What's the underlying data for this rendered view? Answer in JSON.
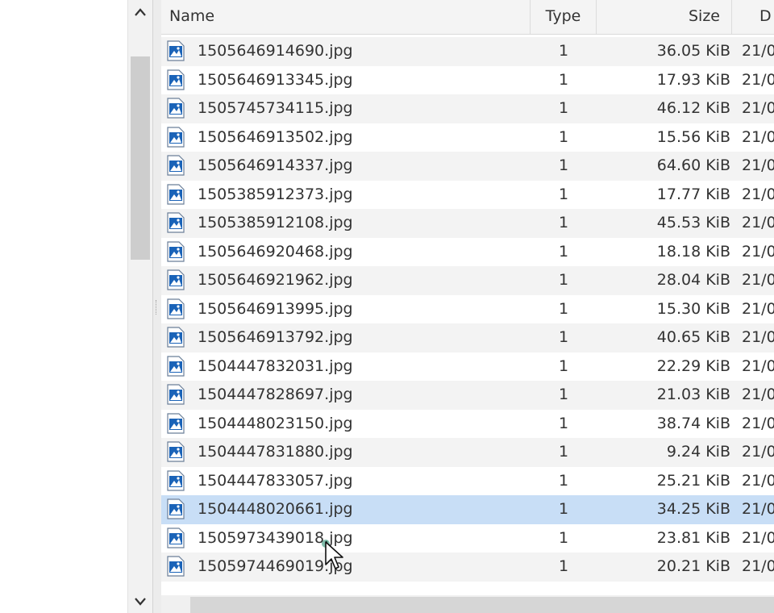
{
  "left_pane": {
    "scroll_up_icon": "chevron-up-icon",
    "scroll_down_icon": "chevron-down-icon",
    "up_glyph": "^",
    "down_glyph": "v"
  },
  "columns": {
    "name": "Name",
    "type": "Type",
    "size": "Size",
    "date": "D"
  },
  "files": [
    {
      "name": "1505646914690.jpg",
      "type": "1",
      "size": "36.05 KiB",
      "date": "21/0"
    },
    {
      "name": "1505646913345.jpg",
      "type": "1",
      "size": "17.93 KiB",
      "date": "21/0"
    },
    {
      "name": "1505745734115.jpg",
      "type": "1",
      "size": "46.12 KiB",
      "date": "21/0"
    },
    {
      "name": "1505646913502.jpg",
      "type": "1",
      "size": "15.56 KiB",
      "date": "21/0"
    },
    {
      "name": "1505646914337.jpg",
      "type": "1",
      "size": "64.60 KiB",
      "date": "21/0"
    },
    {
      "name": "1505385912373.jpg",
      "type": "1",
      "size": "17.77 KiB",
      "date": "21/0"
    },
    {
      "name": "1505385912108.jpg",
      "type": "1",
      "size": "45.53 KiB",
      "date": "21/0"
    },
    {
      "name": "1505646920468.jpg",
      "type": "1",
      "size": "18.18 KiB",
      "date": "21/0"
    },
    {
      "name": "1505646921962.jpg",
      "type": "1",
      "size": "28.04 KiB",
      "date": "21/0"
    },
    {
      "name": "1505646913995.jpg",
      "type": "1",
      "size": "15.30 KiB",
      "date": "21/0"
    },
    {
      "name": "1505646913792.jpg",
      "type": "1",
      "size": "40.65 KiB",
      "date": "21/0"
    },
    {
      "name": "1504447832031.jpg",
      "type": "1",
      "size": "22.29 KiB",
      "date": "21/0"
    },
    {
      "name": "1504447828697.jpg",
      "type": "1",
      "size": "21.03 KiB",
      "date": "21/0"
    },
    {
      "name": "1504448023150.jpg",
      "type": "1",
      "size": "38.74 KiB",
      "date": "21/0"
    },
    {
      "name": "1504447831880.jpg",
      "type": "1",
      "size": "9.24 KiB",
      "date": "21/0"
    },
    {
      "name": "1504447833057.jpg",
      "type": "1",
      "size": "25.21 KiB",
      "date": "21/0"
    },
    {
      "name": "1504448020661.jpg",
      "type": "1",
      "size": "34.25 KiB",
      "date": "21/0",
      "selected": true
    },
    {
      "name": "1505973439018.jpg",
      "type": "1",
      "size": "23.81 KiB",
      "date": "21/0"
    },
    {
      "name": "1505974469019.jpg",
      "type": "1",
      "size": "20.21 KiB",
      "date": "21/0"
    }
  ],
  "icons": {
    "file": "image-file-icon",
    "cursor": "mouse-cursor-icon"
  },
  "colors": {
    "selected_row": "#c8def6",
    "alt_row": "#f3f3f3",
    "icon_blue": "#1a63b8"
  }
}
